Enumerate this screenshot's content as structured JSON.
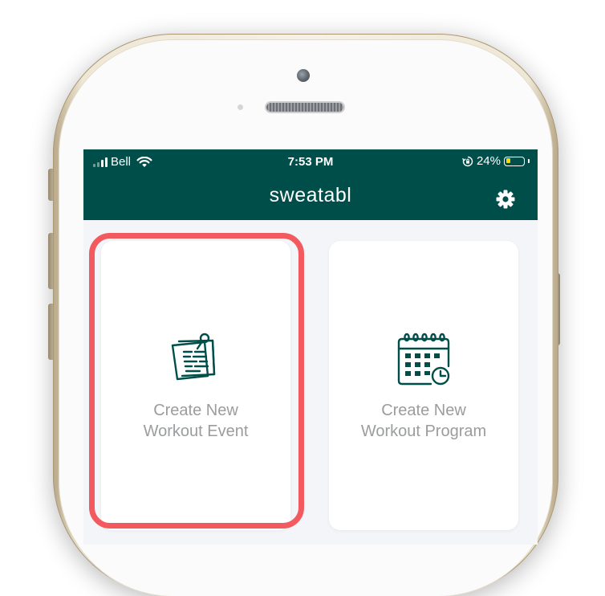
{
  "status_bar": {
    "carrier": "Bell",
    "time": "7:53 PM",
    "battery_percent": "24%",
    "battery_level": 0.24,
    "signal_bars": 4,
    "signal_active": 2
  },
  "app_bar": {
    "title": "sweatabl",
    "settings_icon": "gear-icon",
    "color": "#004e4a"
  },
  "cards": [
    {
      "line1": "Create New",
      "line2": "Workout Event",
      "icon": "pinned-notes-icon",
      "highlighted": true
    },
    {
      "line1": "Create New",
      "line2": "Workout Program",
      "icon": "calendar-clock-icon",
      "highlighted": false
    }
  ],
  "colors": {
    "brand": "#004e4a",
    "highlight": "#f25a5f",
    "label": "#9a9c9e",
    "battery": "#f5d90a"
  }
}
